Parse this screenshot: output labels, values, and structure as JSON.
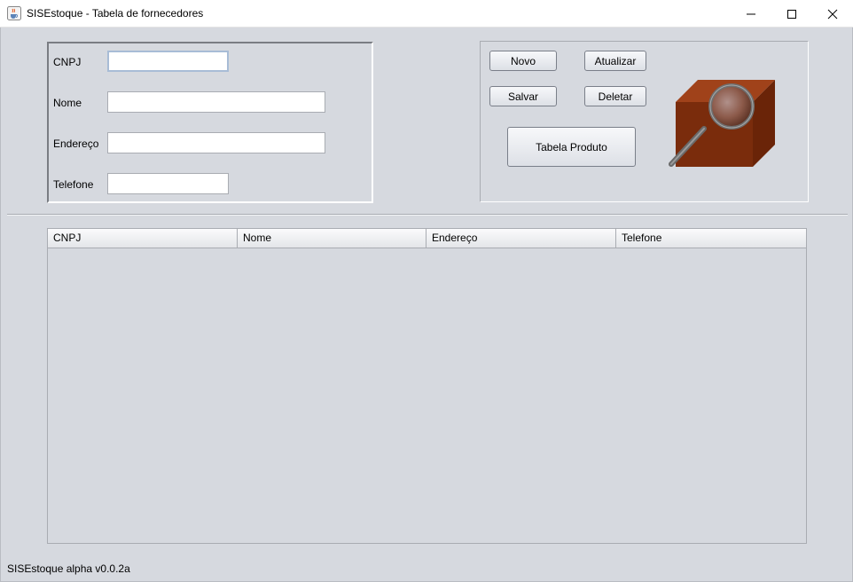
{
  "window": {
    "title": "SISEstoque - Tabela de fornecedores",
    "controls": {
      "minimize": "minimize-icon",
      "maximize": "maximize-icon",
      "close": "close-icon"
    }
  },
  "form": {
    "cnpj": {
      "label": "CNPJ",
      "value": "",
      "placeholder": ""
    },
    "nome": {
      "label": "Nome",
      "value": "",
      "placeholder": ""
    },
    "endereco": {
      "label": "Endereço",
      "value": "",
      "placeholder": ""
    },
    "telefone": {
      "label": "Telefone",
      "value": "",
      "placeholder": ""
    }
  },
  "actions": {
    "novo": "Novo",
    "atualizar": "Atualizar",
    "salvar": "Salvar",
    "deletar": "Deletar",
    "tabela_produto": "Tabela Produto"
  },
  "logo": {
    "icon": "box-magnifier-icon",
    "box_color": "#7a2c0c",
    "lens_color": "#8c5a4a"
  },
  "table": {
    "columns": [
      "CNPJ",
      "Nome",
      "Endereço",
      "Telefone"
    ],
    "rows": []
  },
  "status": {
    "version": "SISEstoque alpha v0.0.2a"
  },
  "colors": {
    "window_bg": "#d6d9df",
    "titlebar_bg": "#ffffff",
    "focus_border": "#a8bcd6"
  }
}
